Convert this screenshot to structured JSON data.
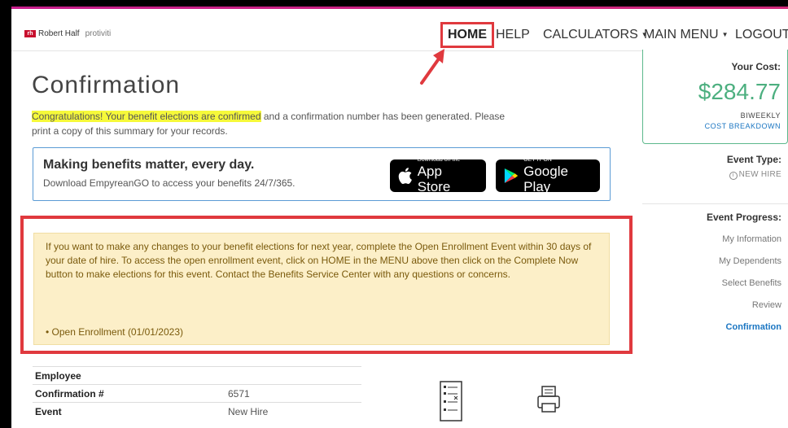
{
  "brand": {
    "name": "Robert Half",
    "mark": "rh",
    "sub": "protiviti"
  },
  "nav": {
    "home": "HOME",
    "help": "HELP",
    "calculators": "CALCULATORS",
    "main_menu": "MAIN MENU",
    "logout": "LOGOUT"
  },
  "page": {
    "title": "Confirmation",
    "congrats_highlight": "Congratulations! Your benefit elections are confirmed",
    "congrats_rest": " and a confirmation number has been generated. Please print a copy of this summary for your records."
  },
  "app_banner": {
    "title": "Making benefits matter, every day.",
    "subtitle": "Download EmpyreanGO to access your benefits 24/7/365.",
    "apple_small": "Download on the",
    "apple_big": "App Store",
    "google_small": "GET IT ON",
    "google_big": "Google Play"
  },
  "notice": {
    "text": "If you want to make any changes to your benefit elections for next year, complete the Open Enrollment Event within 30 days of your date of hire. To access the open enrollment event, click on HOME in the MENU above then click on the Complete Now button to make elections for this event.  Contact the Benefits Service Center with any questions or concerns.",
    "bullet_label": "Open Enrollment ",
    "bullet_date": "(01/01/2023)"
  },
  "summary": {
    "rows": [
      {
        "key": "Employee",
        "value": ""
      },
      {
        "key": "Confirmation #",
        "value": "6571"
      },
      {
        "key": "Event",
        "value": "New Hire"
      }
    ]
  },
  "cost": {
    "label": "Your Cost:",
    "value": "$284.77",
    "period": "BIWEEKLY",
    "breakdown": "COST BREAKDOWN"
  },
  "event_type": {
    "label": "Event Type:",
    "value": "NEW HIRE"
  },
  "progress": {
    "label": "Event Progress:",
    "steps": [
      "My Information",
      "My Dependents",
      "Select Benefits",
      "Review",
      "Confirmation"
    ]
  },
  "colors": {
    "accent_green": "#4caf7f",
    "link_blue": "#1b76c2",
    "highlight_red": "#e0393e",
    "notice_bg": "#fcefc8"
  }
}
